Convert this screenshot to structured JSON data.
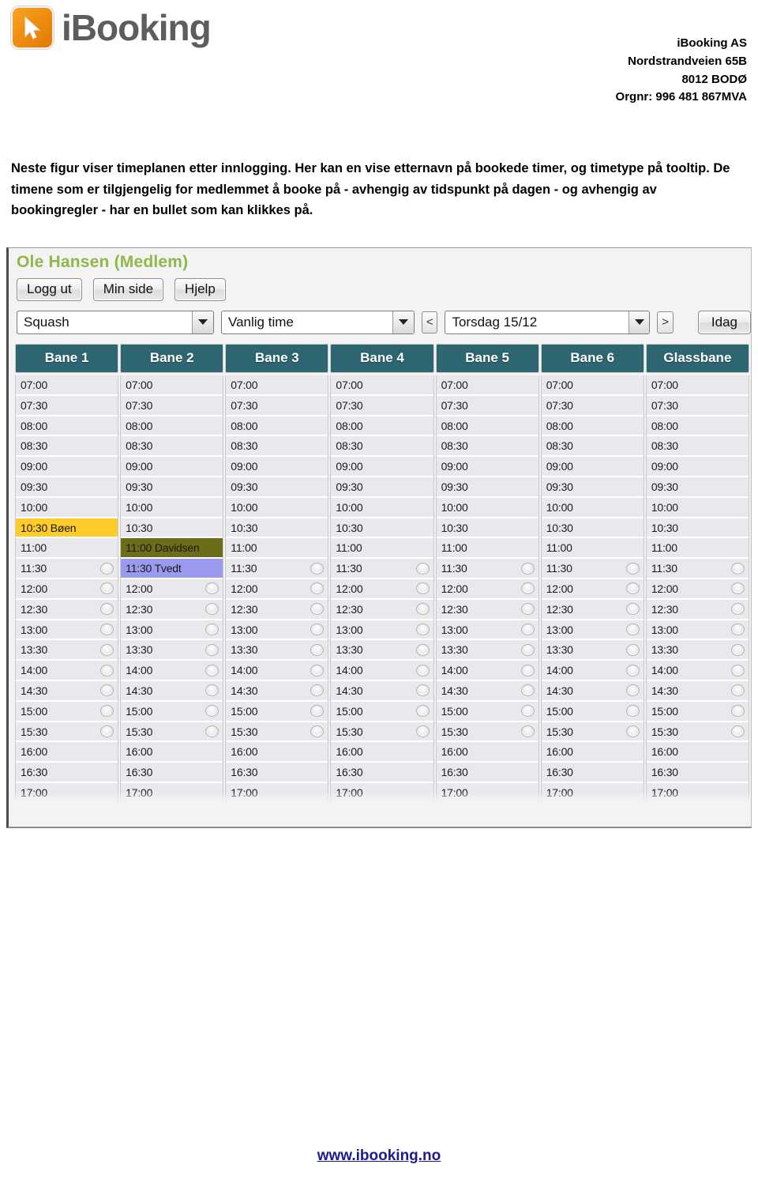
{
  "brand": {
    "name": "iBooking",
    "logo_icon": "cursor-arrow-icon"
  },
  "company": {
    "line1": "iBooking AS",
    "line2": "Nordstrandveien 65B",
    "line3": "8012 BODØ",
    "line4": "Orgnr: 996 481 867MVA"
  },
  "intro": {
    "paragraph": "Neste figur viser timeplanen etter innlogging. Her kan en vise etternavn på bookede timer, og timetype på tooltip. De timene som er tilgjengelig for medlemmet å booke på - avhengig av tidspunkt på dagen - og avhengig av bookingregler - har en bullet som kan klikkes på."
  },
  "app": {
    "user": "Ole Hansen (Medlem)",
    "buttons": {
      "logout": "Logg ut",
      "my_page": "Min side",
      "help": "Hjelp",
      "today": "Idag"
    },
    "selects": {
      "activity": "Squash",
      "time_type": "Vanlig time",
      "date": "Torsdag 15/12"
    },
    "nav": {
      "prev": "<",
      "next": ">"
    },
    "colors": {
      "header_teal": "#2d6670",
      "user_green": "#8fb84a",
      "booking_yellow": "#fdcb2a",
      "booking_olive": "#6d6d18",
      "booking_purple": "#9a9aee",
      "slot_bg": "#e9e9ed"
    },
    "grid": {
      "columns": [
        "Bane 1",
        "Bane 2",
        "Bane 3",
        "Bane 4",
        "Bane 5",
        "Bane 6",
        "Glassbane"
      ],
      "times": [
        "07:00",
        "07:30",
        "08:00",
        "08:30",
        "09:00",
        "09:30",
        "10:00",
        "10:30",
        "11:00",
        "11:30",
        "12:00",
        "12:30",
        "13:00",
        "13:30",
        "14:00",
        "14:30",
        "15:00",
        "15:30",
        "16:00",
        "16:30",
        "17:00"
      ],
      "bullet_times": [
        "11:30",
        "12:00",
        "12:30",
        "13:00",
        "13:30",
        "14:00",
        "14:30",
        "15:00",
        "15:30"
      ],
      "bookings": [
        {
          "column": "Bane 1",
          "time": "10:30",
          "name": "Bøen",
          "label": "10:30 Bøen",
          "style": "book-yellow"
        },
        {
          "column": "Bane 2",
          "time": "11:00",
          "name": "Davidsen",
          "label": "11:00 Davidsen",
          "style": "book-olive"
        },
        {
          "column": "Bane 2",
          "time": "11:30",
          "name": "Tvedt",
          "label": "11:30 Tvedt",
          "style": "book-purple"
        }
      ]
    }
  },
  "footer": {
    "url": "www.ibooking.no"
  }
}
